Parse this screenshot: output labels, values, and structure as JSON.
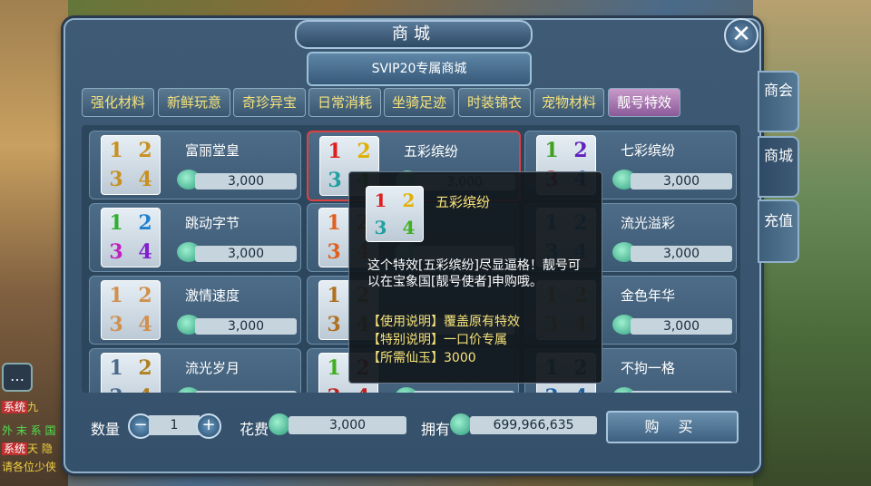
{
  "window": {
    "title": "商城",
    "svip_label": "SVIP20专属商城"
  },
  "tabs": [
    {
      "label": "强化材料",
      "active": false
    },
    {
      "label": "新鲜玩意",
      "active": false
    },
    {
      "label": "奇珍异宝",
      "active": false
    },
    {
      "label": "日常消耗",
      "active": false
    },
    {
      "label": "坐骑足迹",
      "active": false
    },
    {
      "label": "时装锦衣",
      "active": false
    },
    {
      "label": "宠物材料",
      "active": false
    },
    {
      "label": "靓号特效",
      "active": true
    }
  ],
  "side_tabs": [
    {
      "label": "商会"
    },
    {
      "label": "商城"
    },
    {
      "label": "充值"
    }
  ],
  "items": [
    {
      "name": "富丽堂皇",
      "price": "3,000",
      "digits": [
        "1",
        "2",
        "3",
        "4"
      ],
      "colors": [
        "#c89020",
        "#c89020",
        "#c89020",
        "#c89020"
      ]
    },
    {
      "name": "五彩缤纷",
      "price": "3,000",
      "digits": [
        "1",
        "2",
        "3",
        "4"
      ],
      "colors": [
        "#e02020",
        "#e0b000",
        "#20a0a0",
        "#40b020"
      ]
    },
    {
      "name": "七彩缤纷",
      "price": "3,000",
      "digits": [
        "1",
        "2",
        "3",
        "4"
      ],
      "colors": [
        "#40a020",
        "#6020c0",
        "#c02020",
        "#2060c0"
      ]
    },
    {
      "name": "跳动字节",
      "price": "3,000",
      "digits": [
        "1",
        "2",
        "3",
        "4"
      ],
      "colors": [
        "#30b030",
        "#2080d0",
        "#c020c0",
        "#8020d0"
      ]
    },
    {
      "name": "",
      "price": "",
      "digits": [
        "1",
        "2",
        "3",
        "4"
      ],
      "colors": [
        "#e06020",
        "#e06020",
        "#e06020",
        "#e06020"
      ]
    },
    {
      "name": "流光溢彩",
      "price": "3,000",
      "digits": [
        "1",
        "2",
        "3",
        "4"
      ],
      "colors": [
        "#2080c0",
        "#2080c0",
        "#2080c0",
        "#2080c0"
      ]
    },
    {
      "name": "激情速度",
      "price": "3,000",
      "digits": [
        "1",
        "2",
        "3",
        "4"
      ],
      "colors": [
        "#d09050",
        "#d09050",
        "#d09050",
        "#d09050"
      ]
    },
    {
      "name": "",
      "price": "",
      "digits": [
        "1",
        "2",
        "3",
        "4"
      ],
      "colors": [
        "#b07020",
        "#b07020",
        "#b07020",
        "#b07020"
      ]
    },
    {
      "name": "金色年华",
      "price": "3,000",
      "digits": [
        "1",
        "2",
        "3",
        "4"
      ],
      "colors": [
        "#c89020",
        "#c89020",
        "#c89020",
        "#c89020"
      ]
    },
    {
      "name": "流光岁月",
      "price": "",
      "digits": [
        "1",
        "2",
        "3",
        "4"
      ],
      "colors": [
        "#4a6a8a",
        "#b08020",
        "#4a6a8a",
        "#b08020"
      ]
    },
    {
      "name": "",
      "price": "",
      "digits": [
        "1",
        "2",
        "3",
        "4"
      ],
      "colors": [
        "#40b020",
        "#c02020",
        "#c02020",
        "#c02020"
      ]
    },
    {
      "name": "不拘一格",
      "price": "",
      "digits": [
        "1",
        "2",
        "3",
        "4"
      ],
      "colors": [
        "#2060a0",
        "#2060a0",
        "#2060a0",
        "#2060a0"
      ]
    }
  ],
  "tooltip": {
    "title": "五彩缤纷",
    "desc": "这个特效[五彩缤纷]尽显逼格！靓号可以在宝象国[靓号使者]申购哦。",
    "usage": "【使用说明】覆盖原有特效",
    "special": "【特别说明】一口价专属",
    "cost": "【所需仙玉】3000",
    "digits": [
      "1",
      "2",
      "3",
      "4"
    ],
    "colors": [
      "#e02020",
      "#e0b000",
      "#20a0a0",
      "#40b020"
    ]
  },
  "footer": {
    "qty_label": "数量",
    "qty_value": "1",
    "cost_label": "花费",
    "cost_value": "3,000",
    "own_label": "拥有",
    "own_value": "699,966,635",
    "buy_label": "购 买",
    "minus_glyph": "−",
    "plus_glyph": "+"
  },
  "chat": [
    {
      "tag": "系统",
      "text": "九",
      "color": "#f0d040"
    },
    {
      "tag": "",
      "text": "外 末 系 国",
      "color": "#50e050"
    },
    {
      "tag": "系统",
      "text": "天 隐",
      "color": "#f0d040"
    },
    {
      "tag": "",
      "text": "请各位少侠",
      "color": "#f0d040"
    }
  ],
  "icons": {
    "close": "close-icon",
    "chat": "chat-icon",
    "jade": "jade-currency-icon"
  }
}
